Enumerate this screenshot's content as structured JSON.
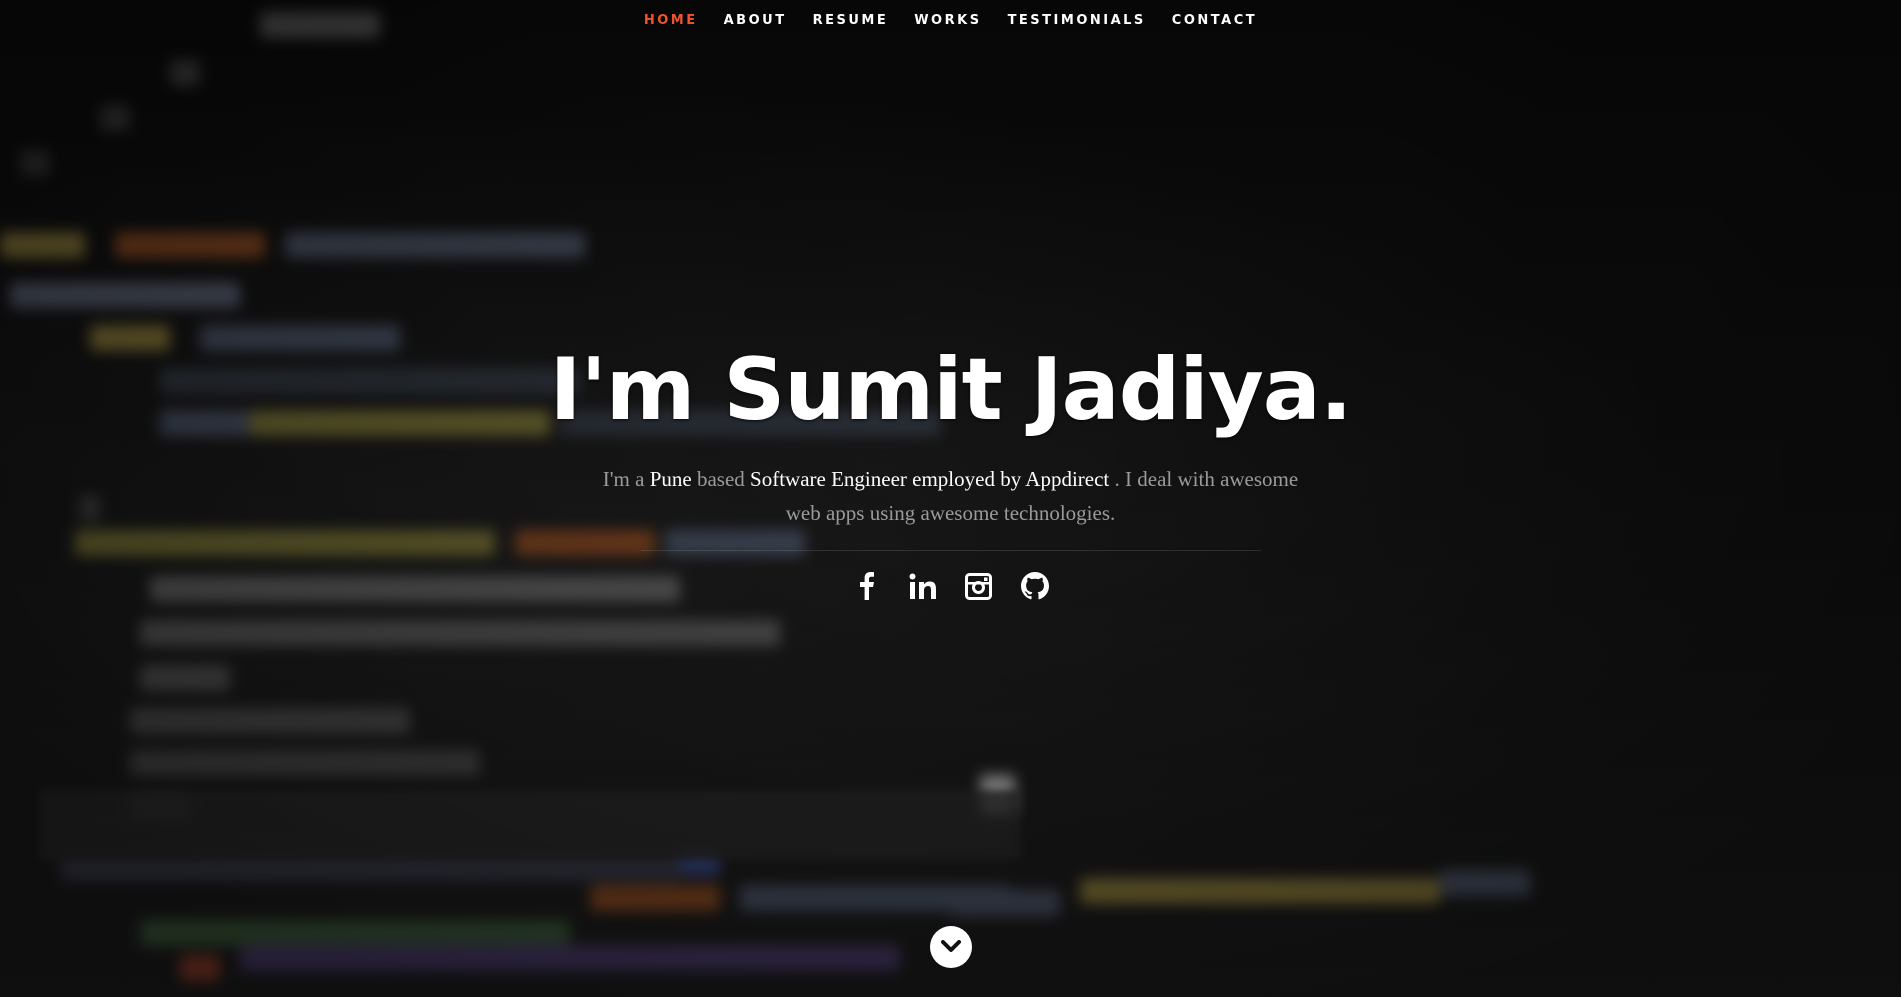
{
  "nav": {
    "items": [
      {
        "label": "HOME",
        "active": true
      },
      {
        "label": "ABOUT",
        "active": false
      },
      {
        "label": "RESUME",
        "active": false
      },
      {
        "label": "WORKS",
        "active": false
      },
      {
        "label": "TESTIMONIALS",
        "active": false
      },
      {
        "label": "CONTACT",
        "active": false
      }
    ],
    "active_color": "#f0542b"
  },
  "banner": {
    "headline": "I'm Sumit Jadiya.",
    "intro": {
      "part1": "I'm a ",
      "location": "Pune",
      "part2": " based ",
      "role": "Software Engineer employed by Appdirect",
      "part3": " . I deal with awesome web apps using awesome technologies."
    }
  },
  "social": [
    {
      "icon": "facebook-icon"
    },
    {
      "icon": "linkedin-icon"
    },
    {
      "icon": "instagram-icon"
    },
    {
      "icon": "github-icon"
    }
  ],
  "scroll": {
    "icon": "chevron-down-icon"
  }
}
